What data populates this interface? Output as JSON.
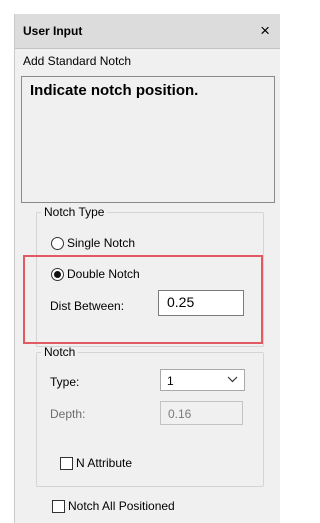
{
  "window": {
    "title": "User Input",
    "close_glyph": "×"
  },
  "subtitle": "Add Standard Notch",
  "prompt": "Indicate notch position.",
  "notch_type": {
    "legend": "Notch Type",
    "single_label": "Single Notch",
    "double_label": "Double Notch",
    "selected": "Double Notch",
    "dist_label": "Dist Between:",
    "dist_value": "0.25"
  },
  "notch": {
    "legend": "Notch",
    "type_label": "Type:",
    "type_value": "1",
    "depth_label": "Depth:",
    "depth_value": "0.16",
    "n_attribute_label": "N Attribute"
  },
  "notch_all_positioned_label": "Notch All Positioned",
  "highlight_color": "#e15a63"
}
